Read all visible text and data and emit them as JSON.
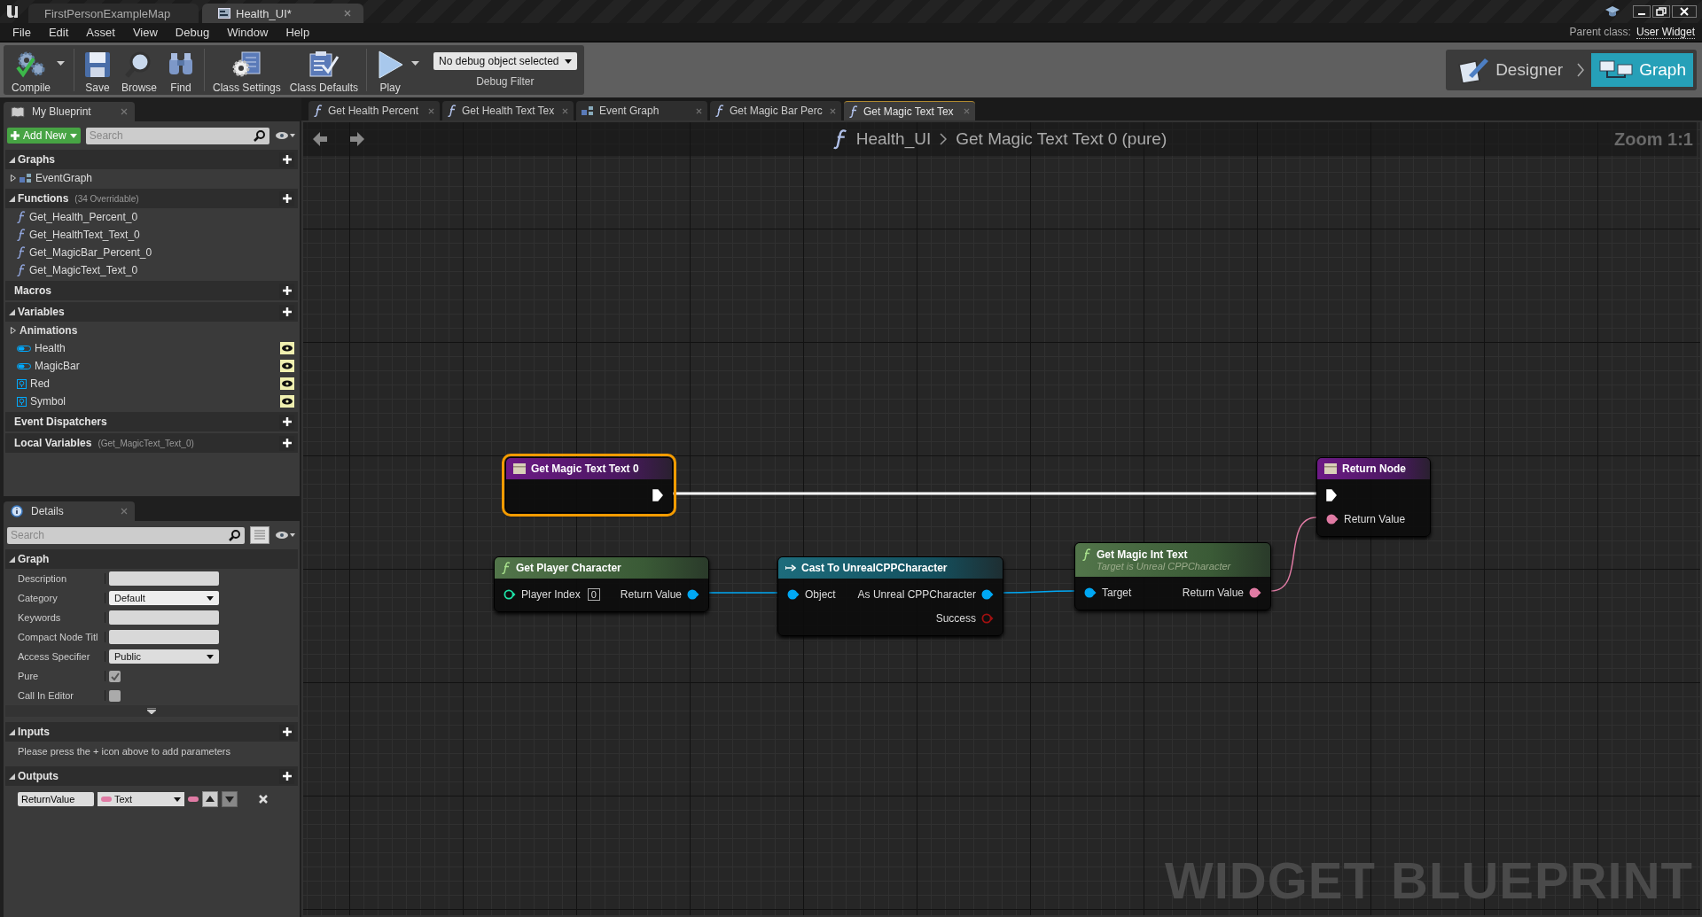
{
  "window": {
    "tabs": [
      {
        "label": "FirstPersonExampleMap",
        "selected": false
      },
      {
        "label": "Health_UI*",
        "selected": true
      }
    ]
  },
  "menu": [
    "File",
    "Edit",
    "Asset",
    "View",
    "Debug",
    "Window",
    "Help"
  ],
  "parent_class": {
    "label": "Parent class:",
    "value": "User Widget"
  },
  "toolbar": [
    [
      {
        "label": "Compile",
        "kind": "compile",
        "menu": true
      }
    ],
    [
      {
        "label": "Save",
        "kind": "save",
        "menu": false
      },
      {
        "label": "Browse",
        "kind": "browse",
        "menu": false
      },
      {
        "label": "Find",
        "kind": "find",
        "menu": false
      }
    ],
    [
      {
        "label": "Class Settings",
        "kind": "settings",
        "menu": false
      },
      {
        "label": "Class Defaults",
        "kind": "defaults",
        "menu": false
      }
    ],
    [
      {
        "label": "Play",
        "kind": "play",
        "menu": true
      }
    ]
  ],
  "debug_filter": {
    "value": "No debug object selected",
    "label": "Debug Filter"
  },
  "modes": [
    {
      "label": "Designer",
      "kind": "designer",
      "selected": false
    },
    {
      "label": "Graph",
      "kind": "graph",
      "selected": true
    }
  ],
  "my_blueprint": {
    "tab": "My Blueprint",
    "add_new": "Add New",
    "search_placeholder": "Search",
    "sections": [
      {
        "title": "Graphs",
        "expanded": true,
        "items": [
          {
            "label": "EventGraph",
            "kind": "graph",
            "expanded": false
          }
        ]
      },
      {
        "title": "Functions",
        "note": "(34 Overridable)",
        "expanded": true,
        "items": [
          {
            "label": "Get_Health_Percent_0",
            "kind": "function"
          },
          {
            "label": "Get_HealthText_Text_0",
            "kind": "function"
          },
          {
            "label": "Get_MagicBar_Percent_0",
            "kind": "function"
          },
          {
            "label": "Get_MagicText_Text_0",
            "kind": "function"
          }
        ]
      },
      {
        "title": "Macros"
      },
      {
        "title": "Variables",
        "expanded": true,
        "items": [
          {
            "label": "Animations",
            "kind": "category",
            "expanded": false
          },
          {
            "label": "Health",
            "kind": "progress-bar"
          },
          {
            "label": "MagicBar",
            "kind": "progress-bar"
          },
          {
            "label": "Red",
            "kind": "image"
          },
          {
            "label": "Symbol",
            "kind": "image"
          }
        ]
      },
      {
        "title": "Event Dispatchers"
      },
      {
        "title": "Local Variables",
        "note": "(Get_MagicText_Text_0)"
      }
    ]
  },
  "details": {
    "tab": "Details",
    "search_placeholder": "Search",
    "graph": {
      "title": "Graph",
      "rows": [
        {
          "label": "Description",
          "kind": "text"
        },
        {
          "label": "Category",
          "kind": "combo",
          "value": "Default"
        },
        {
          "label": "Keywords",
          "kind": "text"
        },
        {
          "label": "Compact Node Titl",
          "kind": "text"
        },
        {
          "label": "Access Specifier",
          "kind": "dropdown",
          "value": "Public"
        },
        {
          "label": "Pure",
          "kind": "checkbox",
          "checked": true
        },
        {
          "label": "Call In Editor",
          "kind": "checkbox",
          "checked": false
        }
      ]
    },
    "inputs": {
      "title": "Inputs",
      "note": "Please press the + icon above to add parameters"
    },
    "outputs": {
      "title": "Outputs",
      "rows": [
        {
          "name": "ReturnValue",
          "type": "Text"
        }
      ]
    }
  },
  "graph_tabs": [
    {
      "label": "Get Health Percent",
      "kind": "function",
      "selected": false
    },
    {
      "label": "Get Health Text Tex",
      "kind": "function",
      "selected": false
    },
    {
      "label": "Event Graph",
      "kind": "graph",
      "selected": false
    },
    {
      "label": "Get Magic Bar Perc",
      "kind": "function",
      "selected": false
    },
    {
      "label": "Get Magic Text Tex",
      "kind": "function",
      "selected": true
    }
  ],
  "breadcrumb": {
    "owner": "Health_UI",
    "current": "Get Magic Text Text 0 (pure)"
  },
  "zoom": "Zoom 1:1",
  "watermark": "WIDGET BLUEPRINT",
  "nodes": [
    {
      "kind": "entry",
      "title": "Get Magic Text Text 0",
      "selected": true,
      "outputs": [
        {
          "kind": "exec",
          "connected": true
        }
      ]
    },
    {
      "kind": "function",
      "title": "Get Player Character",
      "selected": false,
      "inputs": [
        {
          "kind": "data",
          "color": "#1ee3a8",
          "label": "Player Index",
          "default": "0",
          "connected": false
        }
      ],
      "outputs": [
        {
          "kind": "data",
          "color": "#00a8f4",
          "label": "Return Value",
          "connected": true
        }
      ]
    },
    {
      "kind": "cast",
      "title": "Cast To UnrealCPPCharacter",
      "selected": false,
      "inputs": [
        {
          "kind": "data",
          "color": "#00a8f4",
          "label": "Object",
          "connected": true
        }
      ],
      "outputs": [
        {
          "kind": "data",
          "color": "#00a8f4",
          "label": "As Unreal CPPCharacter",
          "connected": true
        },
        {
          "kind": "data",
          "color": "#a01010",
          "label": "Success",
          "connected": false
        }
      ]
    },
    {
      "kind": "function",
      "title": "Get Magic Int Text",
      "subtitle": "Target is Unreal CPPCharacter",
      "selected": false,
      "inputs": [
        {
          "kind": "data",
          "color": "#00a8f4",
          "label": "Target",
          "connected": true
        }
      ],
      "outputs": [
        {
          "kind": "data",
          "color": "#e07ba4",
          "label": "Return Value",
          "connected": true
        }
      ]
    },
    {
      "kind": "return",
      "title": "Return Node",
      "selected": false,
      "inputs": [
        {
          "kind": "exec",
          "connected": true
        },
        {
          "kind": "data",
          "color": "#e07ba4",
          "label": "Return Value",
          "connected": true
        }
      ]
    }
  ]
}
